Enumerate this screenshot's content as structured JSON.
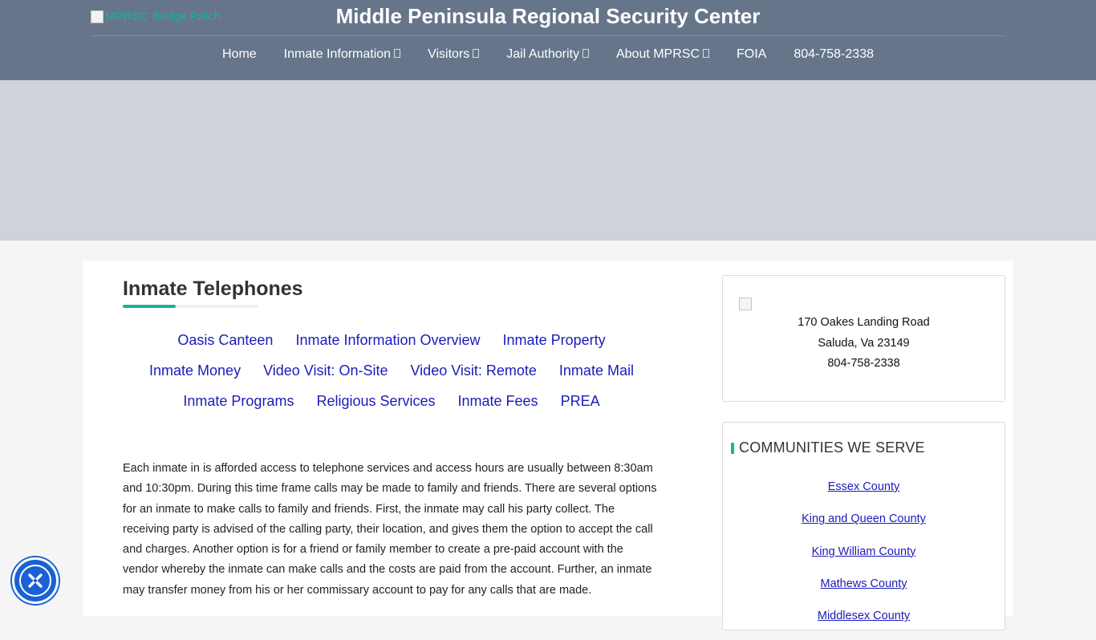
{
  "header": {
    "logo_alt": "MPRSC Badge Patch",
    "site_title": "Middle Peninsula Regional Security Center",
    "nav": [
      {
        "label": "Home",
        "dropdown": false
      },
      {
        "label": "Inmate Information",
        "dropdown": true
      },
      {
        "label": "Visitors",
        "dropdown": true
      },
      {
        "label": "Jail Authority",
        "dropdown": true
      },
      {
        "label": "About MPRSC",
        "dropdown": true
      },
      {
        "label": "FOIA",
        "dropdown": false
      },
      {
        "label": "804-758-2338",
        "dropdown": false
      }
    ]
  },
  "main": {
    "page_title": "Inmate Telephones",
    "links": [
      [
        "Oasis Canteen",
        "Inmate Information Overview",
        "Inmate Property"
      ],
      [
        "Inmate Money",
        "Video Visit: On-Site",
        "Video Visit: Remote",
        "Inmate Mail"
      ],
      [
        "Inmate Programs",
        "Religious Services",
        "Inmate Fees",
        "PREA"
      ]
    ],
    "body_text": "Each inmate in is afforded access to telephone services and access hours are usually between 8:30am and 10:30pm. During this time frame calls may be made to family and friends.  There are several options for an inmate to make calls to family and friends.  First, the inmate may call his party collect. The receiving party is advised of the calling party, their location, and gives them the option to accept the call and charges. Another option is for a friend or family member to create a pre-paid account with the vendor whereby the inmate can make calls and the costs are paid from the account. Further, an inmate may transfer money from his or her commissary account to pay for any calls that are made."
  },
  "sidebar": {
    "address": {
      "line1": "170 Oakes Landing Road",
      "line2": "Saluda, Va 23149",
      "phone": "804-758-2338"
    },
    "communities": {
      "heading": "COMMUNITIES WE SERVE",
      "items": [
        "Essex County",
        "King and Queen County",
        "King William County",
        "Mathews County",
        "Middlesex County"
      ]
    }
  },
  "colors": {
    "header_bg": "#66758a",
    "accent": "#1ab394",
    "link": "#1b1bbb",
    "hero_bg": "#cfd2d9",
    "a11y_button": "#1a61d6"
  },
  "icons": {
    "caret": "chevron-down-icon",
    "accessibility": "accessibility-icon"
  }
}
